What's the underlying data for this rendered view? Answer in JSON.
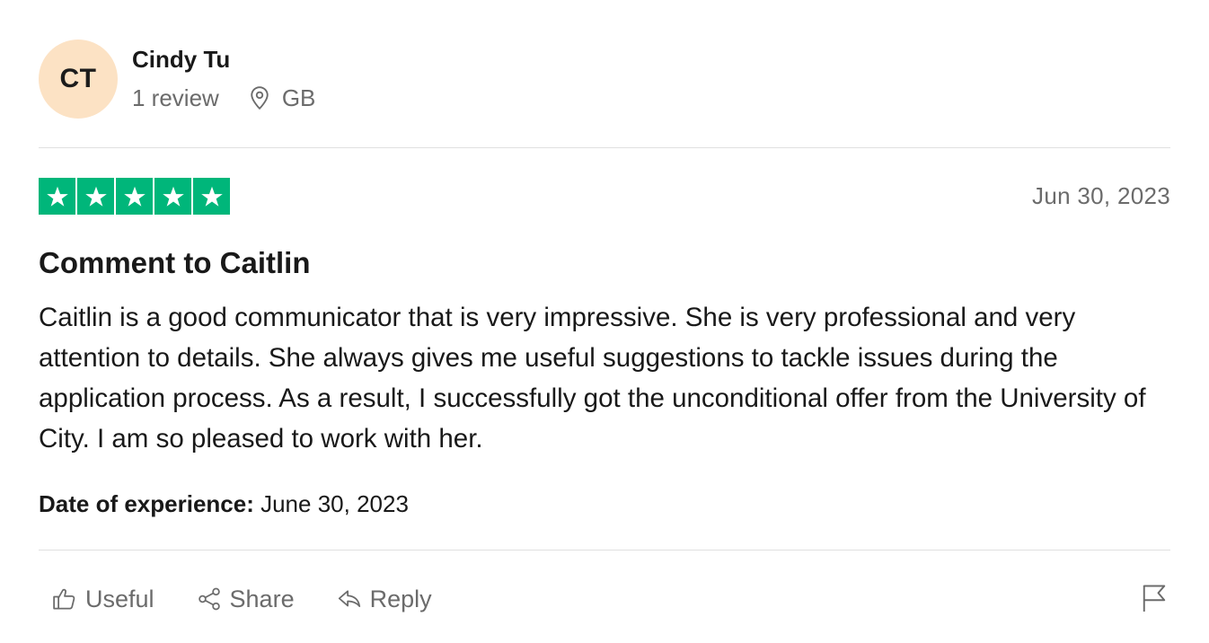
{
  "reviewer": {
    "initials": "CT",
    "name": "Cindy Tu",
    "review_count": "1 review",
    "country": "GB",
    "avatar_color": "#fce2c4"
  },
  "rating": {
    "stars": 5,
    "max_stars": 5,
    "star_color": "#00b67a",
    "star_icon": "star-icon"
  },
  "review": {
    "date": "Jun 30, 2023",
    "title": "Comment to Caitlin",
    "body": "Caitlin is a good communicator that is very impressive. She is very professional and very attention to details. She always gives me useful suggestions to tackle issues during the application process. As a result, I successfully got the unconditional offer from the University of City. I am so pleased to work with her.",
    "experience_label": "Date of experience:",
    "experience_date": " June 30, 2023"
  },
  "actions": {
    "useful": {
      "label": "Useful",
      "icon": "thumbs-up-icon"
    },
    "share": {
      "label": "Share",
      "icon": "share-icon"
    },
    "reply": {
      "label": "Reply",
      "icon": "reply-icon"
    },
    "report": {
      "icon": "flag-icon"
    }
  },
  "colors": {
    "text_primary": "#191919",
    "text_secondary": "#6b6b6b",
    "divider": "#e0e0e0"
  }
}
